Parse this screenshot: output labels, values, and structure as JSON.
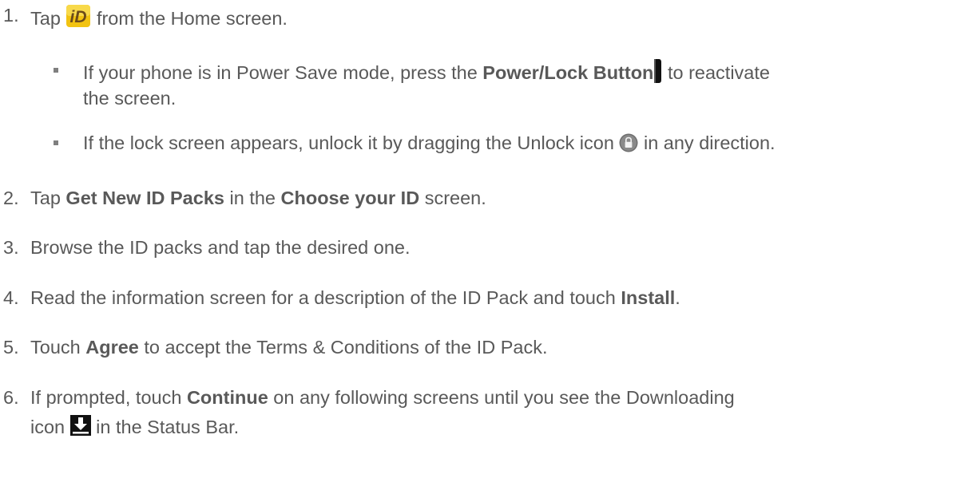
{
  "steps": [
    {
      "number": "1.",
      "pre": "Tap ",
      "icon": "id-app-icon",
      "post": " from the Home screen.",
      "subitems": [
        {
          "pre": "If your phone is in Power Save mode, press the ",
          "bold": "Power/Lock Button",
          "icon": "power-lock-button-icon",
          "post": " to reactivate",
          "continuation": "the screen."
        },
        {
          "pre": "If the lock screen appears, unlock it by dragging the Unlock icon ",
          "icon": "unlock-icon",
          "post": " in any direction."
        }
      ]
    },
    {
      "number": "2.",
      "pre": "Tap ",
      "bold1": "Get New ID Packs",
      "mid": " in the ",
      "bold2": "Choose your ID",
      "post": " screen."
    },
    {
      "number": "3.",
      "text": "Browse the ID packs and tap the desired one."
    },
    {
      "number": "4.",
      "pre": "Read the information screen for a description of the ID Pack and touch ",
      "bold": "Install",
      "post": "."
    },
    {
      "number": "5.",
      "pre": "Touch ",
      "bold": "Agree",
      "post": " to accept the Terms & Conditions of the ID Pack."
    },
    {
      "number": "6.",
      "pre": "If prompted, touch ",
      "bold": "Continue",
      "post": " on any following screens until you see the Downloading",
      "continuation_pre": "icon ",
      "icon": "download-icon",
      "continuation_post": " in the Status Bar."
    }
  ],
  "colors": {
    "text": "#595959",
    "id_icon_bg": "#f2c311",
    "id_icon_letters": "#6b4a1a"
  }
}
